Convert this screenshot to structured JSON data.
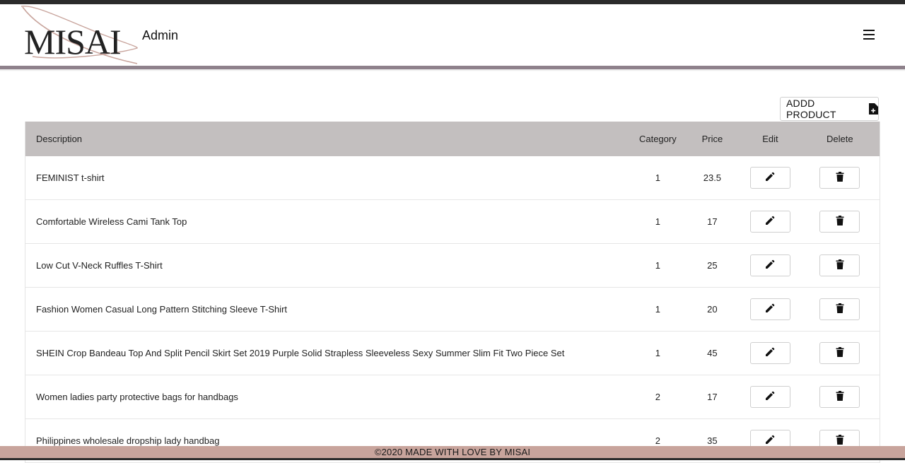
{
  "brand": {
    "logo_text": "MISAI",
    "page_title": "Admin"
  },
  "header": {
    "menu_icon": "menu-icon"
  },
  "actions": {
    "add_product_label": "ADDD PRODUCT",
    "add_product_icon": "file-plus-icon"
  },
  "table": {
    "headers": {
      "description": "Description",
      "category": "Category",
      "price": "Price",
      "edit": "Edit",
      "delete": "Delete"
    },
    "rows": [
      {
        "description": "FEMINIST t-shirt",
        "category": "1",
        "price": "23.5"
      },
      {
        "description": "Comfortable Wireless Cami Tank Top",
        "category": "1",
        "price": "17"
      },
      {
        "description": "Low Cut V-Neck Ruffles T-Shirt",
        "category": "1",
        "price": "25"
      },
      {
        "description": "Fashion Women Casual Long Pattern Stitching Sleeve T-Shirt",
        "category": "1",
        "price": "20"
      },
      {
        "description": "SHEIN Crop Bandeau Top And Split Pencil Skirt Set 2019 Purple Solid Strapless Sleeveless Sexy Summer Slim Fit Two Piece Set",
        "category": "1",
        "price": "45"
      },
      {
        "description": "Women ladies party protective bags for handbags",
        "category": "2",
        "price": "17"
      },
      {
        "description": "Philippines wholesale dropship lady handbag",
        "category": "2",
        "price": "35"
      }
    ]
  },
  "footer": {
    "text": "©2020 MADE WITH LOVE BY MISAI"
  },
  "colors": {
    "header_band": "#8e818b",
    "table_header": "#c3bfbf",
    "footer": "#c8a49c",
    "logo_swoosh": "#c8a49c"
  }
}
